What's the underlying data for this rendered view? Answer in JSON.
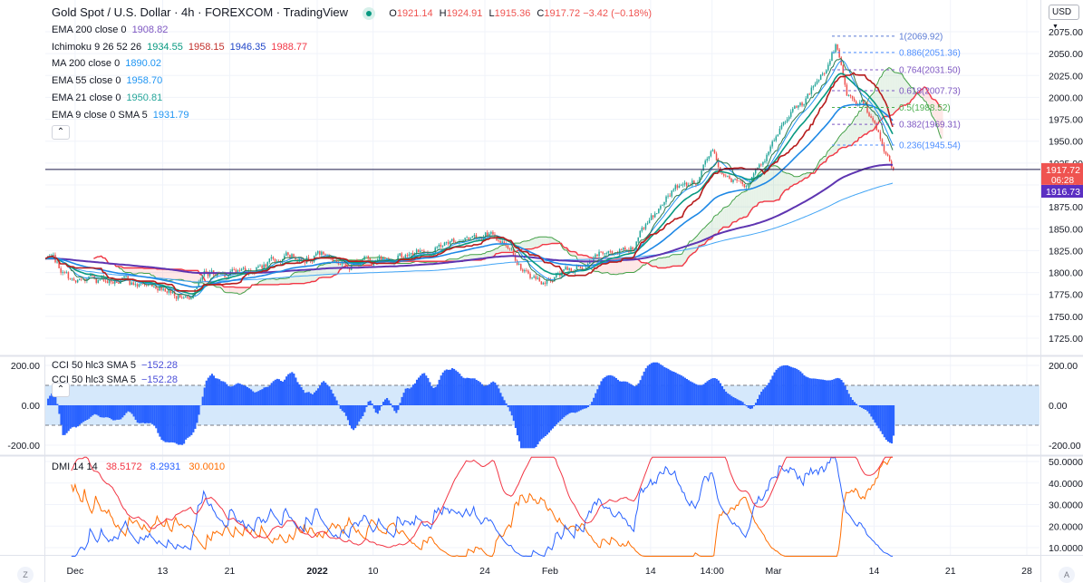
{
  "header": {
    "title": "Gold Spot / U.S. Dollar · 4h · FOREXCOM · TradingView",
    "ohlc": {
      "o_label": "O",
      "o": "1921.14",
      "h_label": "H",
      "h": "1924.91",
      "l_label": "L",
      "l": "1915.36",
      "c_label": "C",
      "c": "1917.72",
      "change": "−3.42 (−0.18%)"
    }
  },
  "indicators": [
    {
      "label": "EMA 200 close 0",
      "values": [
        "1908.82"
      ],
      "colors": [
        "#7e57c2"
      ]
    },
    {
      "label": "Ichimoku 9 26 52 26",
      "values": [
        "1934.55",
        "1958.15",
        "1946.35",
        "1988.77"
      ],
      "colors": [
        "#089981",
        "#c2302b",
        "#2046c8",
        "#f23645"
      ]
    },
    {
      "label": "MA 200 close 0",
      "values": [
        "1890.02"
      ],
      "colors": [
        "#2196f3"
      ]
    },
    {
      "label": "EMA 55 close 0",
      "values": [
        "1958.70"
      ],
      "colors": [
        "#2196f3"
      ]
    },
    {
      "label": "EMA 21 close 0",
      "values": [
        "1950.81"
      ],
      "colors": [
        "#26a69a"
      ]
    },
    {
      "label": "EMA 9 close 0 SMA 5",
      "values": [
        "1931.79"
      ],
      "colors": [
        "#2196f3"
      ]
    }
  ],
  "collapse_icon": "chevron-up-icon",
  "currency_selector": "USD",
  "price_axis": {
    "ticks": [
      "2075.00",
      "2050.00",
      "2025.00",
      "2000.00",
      "1975.00",
      "1950.00",
      "1925.00",
      "1900.00",
      "1875.00",
      "1850.00",
      "1825.00",
      "1800.00",
      "1775.00",
      "1750.00",
      "1725.00"
    ],
    "last_price": "1917.72",
    "countdown": "06:28",
    "ema_price": "1916.73"
  },
  "cci_pane": {
    "legend": [
      {
        "label": "CCI 50 hlc3 SMA 5",
        "value": "−152.28"
      },
      {
        "label": "CCI 50 hlc3 SMA 5",
        "value": "−152.28"
      }
    ],
    "ticks_left": [
      "200.00",
      "0.00",
      "-200.00"
    ],
    "ticks_right": [
      "200.00",
      "0.00",
      "-200.00"
    ]
  },
  "dmi_pane": {
    "label": "DMI 14 14",
    "values": [
      "38.5172",
      "8.2931",
      "30.0010"
    ],
    "colors": [
      "#f23645",
      "#2962ff",
      "#ff6d00"
    ],
    "ticks": [
      "50.0000",
      "40.0000",
      "30.0000",
      "20.0000",
      "10.0000"
    ]
  },
  "time_axis": {
    "labels": [
      {
        "text": "Dec",
        "bar": 16
      },
      {
        "text": "13",
        "bar": 63
      },
      {
        "text": "21",
        "bar": 99
      },
      {
        "text": "2022",
        "bar": 146,
        "bold": true
      },
      {
        "text": "10",
        "bar": 176
      },
      {
        "text": "24",
        "bar": 236
      },
      {
        "text": "Feb",
        "bar": 271
      },
      {
        "text": "14",
        "bar": 325
      },
      {
        "text": "14:00",
        "bar": 358
      },
      {
        "text": "Mar",
        "bar": 391
      },
      {
        "text": "14",
        "bar": 445
      },
      {
        "text": "21",
        "bar": 486
      },
      {
        "text": "28",
        "bar": 527
      }
    ],
    "left_button": "Z",
    "right_button": "A"
  },
  "chart_data": {
    "type": "candlestick",
    "symbol": "XAUUSD 4h",
    "ylim": [
      1725,
      2075
    ],
    "price_path": [
      [
        0,
        1815
      ],
      [
        16,
        1785
      ],
      [
        30,
        1792
      ],
      [
        50,
        1785
      ],
      [
        63,
        1788
      ],
      [
        75,
        1772
      ],
      [
        85,
        1792
      ],
      [
        99,
        1800
      ],
      [
        120,
        1810
      ],
      [
        140,
        1822
      ],
      [
        146,
        1825
      ],
      [
        160,
        1810
      ],
      [
        176,
        1815
      ],
      [
        200,
        1822
      ],
      [
        220,
        1838
      ],
      [
        236,
        1845
      ],
      [
        250,
        1832
      ],
      [
        258,
        1800
      ],
      [
        268,
        1790
      ],
      [
        275,
        1800
      ],
      [
        290,
        1805
      ],
      [
        300,
        1820
      ],
      [
        315,
        1832
      ],
      [
        325,
        1860
      ],
      [
        340,
        1898
      ],
      [
        350,
        1905
      ],
      [
        358,
        1945
      ],
      [
        363,
        1915
      ],
      [
        375,
        1905
      ],
      [
        385,
        1935
      ],
      [
        395,
        1962
      ],
      [
        410,
        2000
      ],
      [
        420,
        2040
      ],
      [
        424,
        2060
      ],
      [
        430,
        2000
      ],
      [
        440,
        1990
      ],
      [
        445,
        1962
      ],
      [
        452,
        1930
      ],
      [
        455,
        1917.72
      ]
    ],
    "fibonacci": [
      {
        "label": "1(2069.92)",
        "price": 2069.92,
        "color": "#5b7bd5"
      },
      {
        "label": "0.886(2051.36)",
        "price": 2051.36,
        "color": "#4c8dff"
      },
      {
        "label": "0.764(2031.50)",
        "price": 2031.5,
        "color": "#7e57c2"
      },
      {
        "label": "0.618(2007.73)",
        "price": 2007.73,
        "color": "#7e57c2"
      },
      {
        "label": "0.5(1988.52)",
        "price": 1988.52,
        "color": "#4caf50"
      },
      {
        "label": "0.382(1969.31)",
        "price": 1969.31,
        "color": "#7e57c2"
      },
      {
        "label": "0.236(1945.54)",
        "price": 1945.54,
        "color": "#4c8dff"
      }
    ],
    "cci_ylim": [
      -200,
      200
    ],
    "dmi_ylim": [
      5,
      50
    ]
  }
}
